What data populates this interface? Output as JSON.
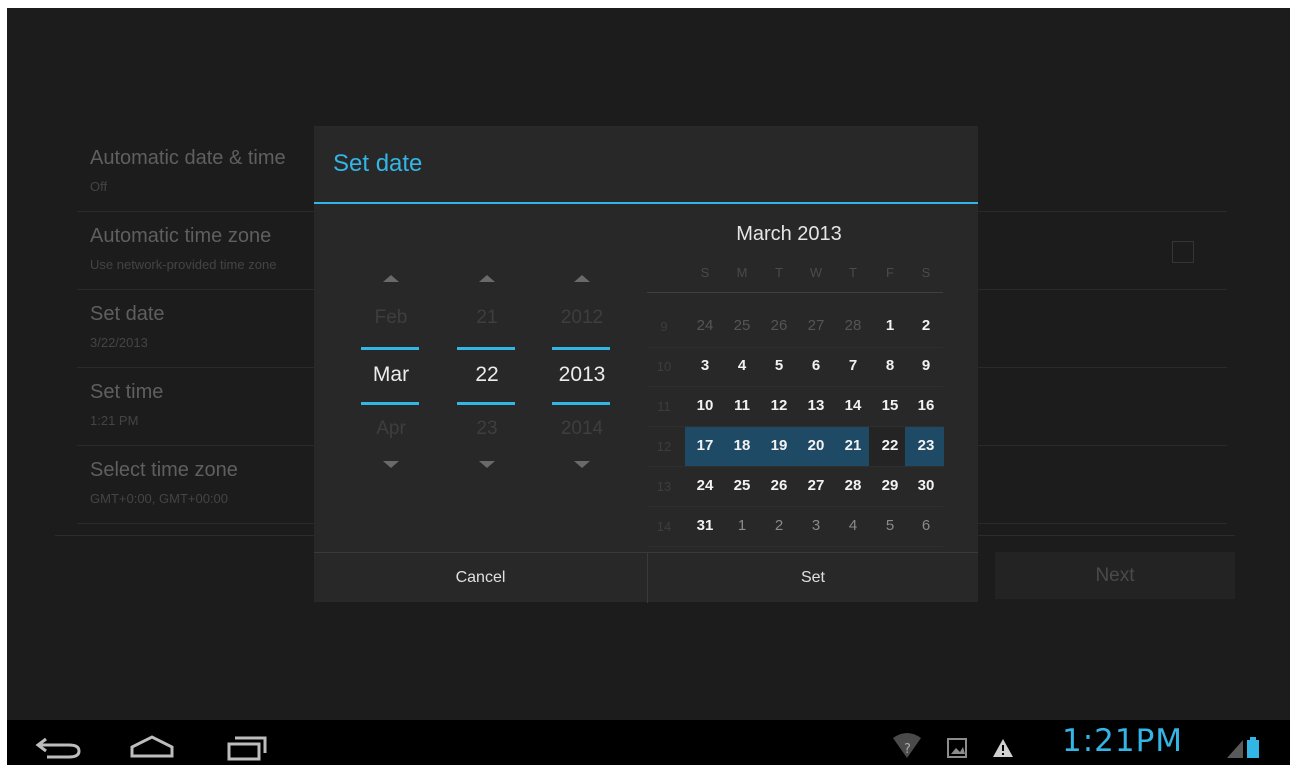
{
  "settings": {
    "items": [
      {
        "title": "Automatic date & time",
        "subtitle": "Off"
      },
      {
        "title": "Automatic time zone",
        "subtitle": "Use network-provided time zone"
      },
      {
        "title": "Set date",
        "subtitle": "3/22/2013"
      },
      {
        "title": "Set time",
        "subtitle": "1:21 PM"
      },
      {
        "title": "Select time zone",
        "subtitle": "GMT+0:00, GMT+00:00"
      }
    ],
    "next_label": "Next"
  },
  "dialog": {
    "title": "Set date",
    "spinners": {
      "month": {
        "prev": "Feb",
        "current": "Mar",
        "next": "Apr"
      },
      "day": {
        "prev": "21",
        "current": "22",
        "next": "23"
      },
      "year": {
        "prev": "2012",
        "current": "2013",
        "next": "2014"
      }
    },
    "calendar": {
      "title": "March 2013",
      "weekdays": [
        "S",
        "M",
        "T",
        "W",
        "T",
        "F",
        "S"
      ],
      "weeks": [
        {
          "num": "9",
          "days": [
            "24",
            "25",
            "26",
            "27",
            "28",
            "1",
            "2"
          ]
        },
        {
          "num": "10",
          "days": [
            "3",
            "4",
            "5",
            "6",
            "7",
            "8",
            "9"
          ]
        },
        {
          "num": "11",
          "days": [
            "10",
            "11",
            "12",
            "13",
            "14",
            "15",
            "16"
          ]
        },
        {
          "num": "12",
          "days": [
            "17",
            "18",
            "19",
            "20",
            "21",
            "22",
            "23"
          ]
        },
        {
          "num": "13",
          "days": [
            "24",
            "25",
            "26",
            "27",
            "28",
            "29",
            "30"
          ]
        },
        {
          "num": "14",
          "days": [
            "31",
            "1",
            "2",
            "3",
            "4",
            "5",
            "6"
          ]
        }
      ],
      "selected_day": "22"
    },
    "cancel_label": "Cancel",
    "set_label": "Set"
  },
  "statusbar": {
    "time": "1:21PM",
    "accent": "#33b5e5"
  }
}
